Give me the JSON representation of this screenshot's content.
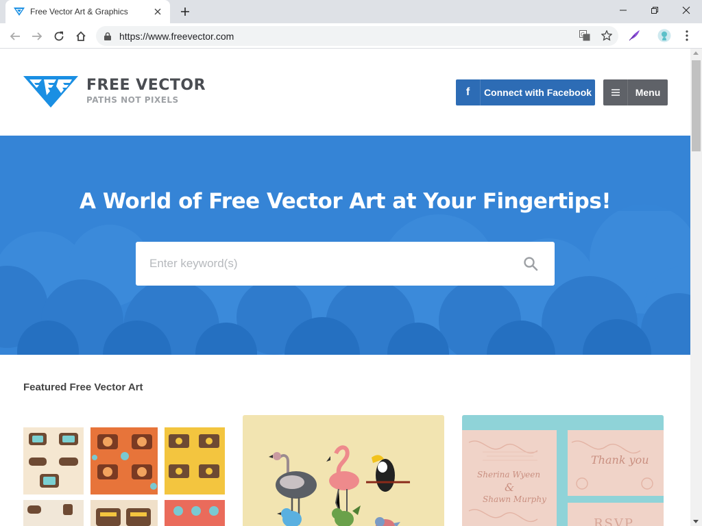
{
  "browser": {
    "tab_title": "Free Vector Art & Graphics",
    "url": "https://www.freevector.com"
  },
  "site": {
    "logo_name": "FREE VECTOR",
    "logo_tagline": "PATHS NOT PIXELS",
    "facebook_button": "Connect with Facebook",
    "facebook_icon_glyph": "f",
    "menu_button": "Menu"
  },
  "hero": {
    "title": "A World of Free Vector Art at Your Fingertips!",
    "search_placeholder": "Enter keyword(s)"
  },
  "featured": {
    "title": "Featured Free Vector Art",
    "card3_text": [
      "Sherina Wyeen",
      "&",
      "Shawn Murphy",
      "Thank you",
      "RSVP"
    ]
  },
  "colors": {
    "brand_blue": "#1a8fe3",
    "hero_bg": "#3584d6",
    "facebook": "#2d6cb5",
    "menu": "#5f6268"
  }
}
